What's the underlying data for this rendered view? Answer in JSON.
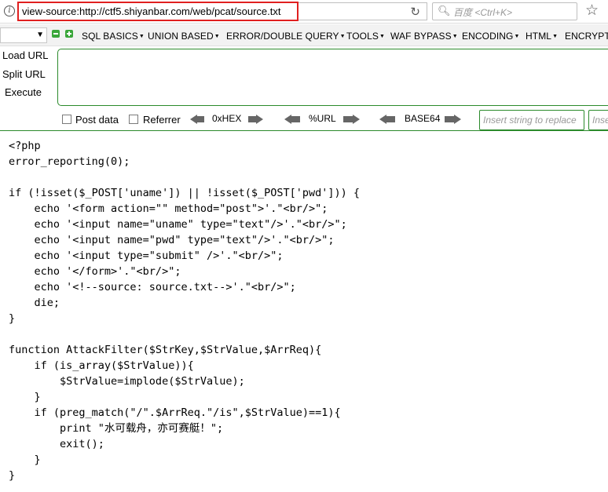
{
  "navbar": {
    "url": "view-source:http://ctf5.shiyanbar.com/web/pcat/source.txt",
    "search_placeholder": "百度 <Ctrl+K>",
    "info_icon": "i"
  },
  "hackbar": {
    "menu": [
      "SQL BASICS",
      "UNION BASED",
      "ERROR/DOUBLE QUERY",
      "TOOLS",
      "WAF BYPASS",
      "ENCODING",
      "HTML",
      "ENCRYPTI"
    ],
    "side_buttons": {
      "load": "Load URL",
      "split": "Split URL",
      "execute": "Execute"
    },
    "checkboxes": {
      "post": "Post data",
      "referrer": "Referrer"
    },
    "encoders": {
      "hex": "0xHEX",
      "url": "%URL",
      "base64": "BASE64"
    },
    "replace_placeholder": "Insert string to replace",
    "replacement_placeholder": "Inse",
    "colors": {
      "accent_green": "#2b8a2b",
      "url_highlight": "#e02020"
    }
  },
  "source_lines": [
    "<?php",
    "error_reporting(0);",
    "",
    "if (!isset($_POST['uname']) || !isset($_POST['pwd'])) {",
    "    echo '<form action=\"\" method=\"post\">'.\"<br/>\";",
    "    echo '<input name=\"uname\" type=\"text\"/>'.\"<br/>\";",
    "    echo '<input name=\"pwd\" type=\"text\"/>'.\"<br/>\";",
    "    echo '<input type=\"submit\" />'.\"<br/>\";",
    "    echo '</form>'.\"<br/>\";",
    "    echo '<!--source: source.txt-->'.\"<br/>\";",
    "    die;",
    "}",
    "",
    "function AttackFilter($StrKey,$StrValue,$ArrReq){",
    "    if (is_array($StrValue)){",
    "        $StrValue=implode($StrValue);",
    "    }",
    "    if (preg_match(\"/\".$ArrReq.\"/is\",$StrValue)==1){",
    "        print \"水可载舟，亦可赛艇！\";",
    "        exit();",
    "    }",
    "}"
  ]
}
